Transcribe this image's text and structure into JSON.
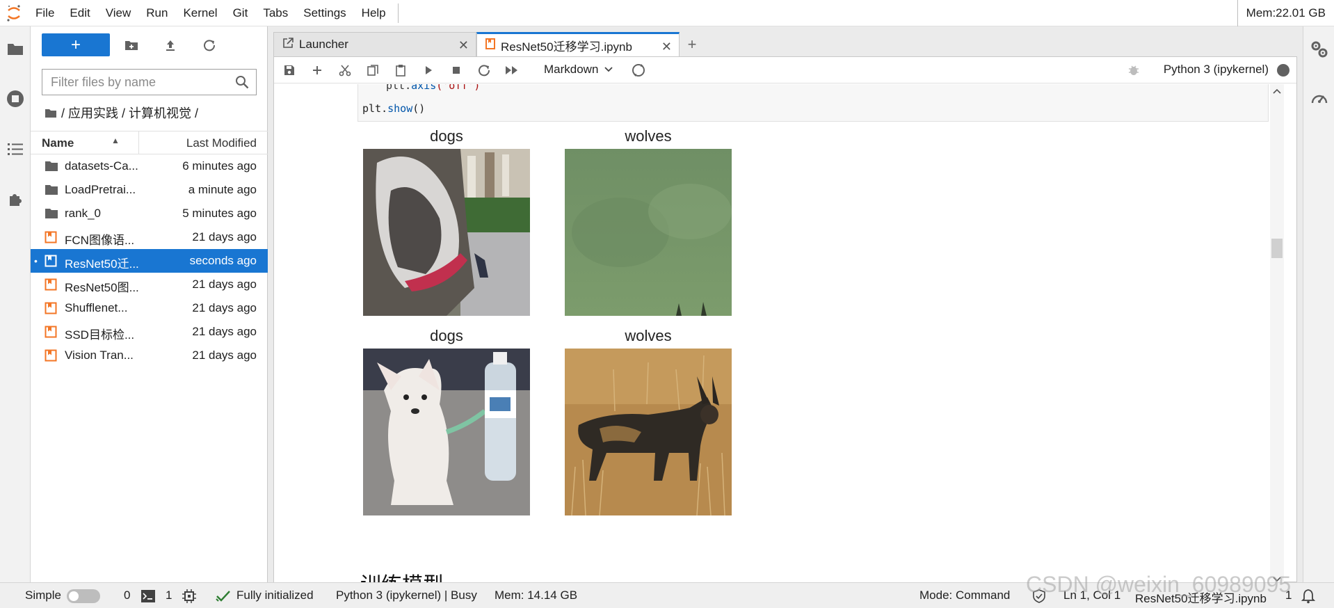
{
  "menubar": {
    "items": [
      "File",
      "Edit",
      "View",
      "Run",
      "Kernel",
      "Git",
      "Tabs",
      "Settings",
      "Help"
    ],
    "memory": "Mem:22.01 GB"
  },
  "filebrowser": {
    "new_label": "+",
    "filter_placeholder": "Filter files by name",
    "breadcrumb": "/ 应用实践 / 计算机视觉 /",
    "header_name": "Name",
    "header_modified": "Last Modified",
    "files": [
      {
        "name": "datasets-Ca...",
        "modified": "6 minutes ago",
        "type": "folder"
      },
      {
        "name": "LoadPretrai...",
        "modified": "a minute ago",
        "type": "folder"
      },
      {
        "name": "rank_0",
        "modified": "5 minutes ago",
        "type": "folder"
      },
      {
        "name": "FCN图像语...",
        "modified": "21 days ago",
        "type": "notebook"
      },
      {
        "name": "ResNet50迁...",
        "modified": "seconds ago",
        "type": "notebook",
        "selected": true
      },
      {
        "name": "ResNet50图...",
        "modified": "21 days ago",
        "type": "notebook"
      },
      {
        "name": "Shufflenet...",
        "modified": "21 days ago",
        "type": "notebook"
      },
      {
        "name": "SSD目标检...",
        "modified": "21 days ago",
        "type": "notebook"
      },
      {
        "name": "Vision Tran...",
        "modified": "21 days ago",
        "type": "notebook"
      }
    ],
    "selected_dot": "•"
  },
  "tabs": [
    {
      "label": "Launcher",
      "active": false
    },
    {
      "label": "ResNet50迁移学习.ipynb",
      "active": true
    }
  ],
  "tab_close": "✕",
  "tab_add": "+",
  "notebook": {
    "cell_type": "Markdown",
    "kernel": "Python 3 (ipykernel)",
    "code_line1_prefix": "plt.",
    "code_line1_func": "axis",
    "code_line1_rest": "('off')",
    "code_line2_prefix": "plt.",
    "code_line2_func": "show",
    "code_line2_rest": "()",
    "images": [
      {
        "title": "dogs"
      },
      {
        "title": "wolves"
      },
      {
        "title": "dogs"
      },
      {
        "title": "wolves"
      }
    ],
    "section_heading": "训练模型"
  },
  "statusbar": {
    "mode_simple": "Simple",
    "count_terminals": "0",
    "count_kernels": "1",
    "init_status": "Fully initialized",
    "kernel_status": "Python 3 (ipykernel) | Busy",
    "memory": "Mem: 14.14 GB",
    "mode": "Mode: Command",
    "cursor": "Ln 1, Col 1",
    "filename": "ResNet50迁移学习.ipynb",
    "notifications": "1"
  },
  "watermark": "CSDN @weixin_60989095",
  "colors": {
    "accent": "#1976d2",
    "notebook_icon": "#f37626"
  }
}
